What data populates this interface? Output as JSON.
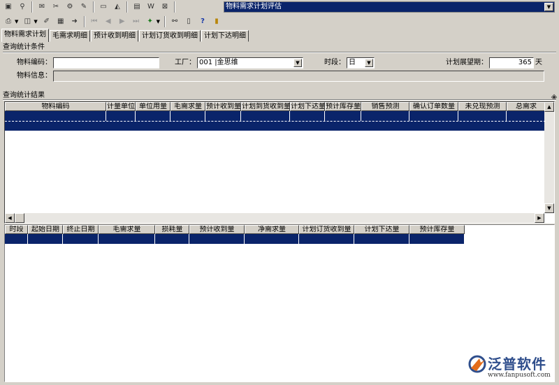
{
  "toolbar1": {
    "icons": [
      "open-icon",
      "find-icon",
      "mail-icon",
      "scissors-icon",
      "gear-icon",
      "plugin-icon",
      "monitor-icon",
      "chart-icon",
      "window-icon",
      "word-icon",
      "close-window-icon"
    ]
  },
  "toolbar2": {
    "icons": [
      "print-icon",
      "print-preview-icon",
      "edit-icon",
      "grid-icon",
      "export-icon",
      "first-icon",
      "prev-icon",
      "next-icon",
      "last-icon",
      "run-icon",
      "network-icon",
      "calculator-icon",
      "help-icon",
      "exit-icon"
    ]
  },
  "module_select": {
    "value": "物料需求计划评估"
  },
  "tabs": [
    {
      "label": "物料需求计划"
    },
    {
      "label": "毛需求明细"
    },
    {
      "label": "预计收到明细"
    },
    {
      "label": "计划订货收到明细"
    },
    {
      "label": "计划下达明细"
    }
  ],
  "query": {
    "section_title": "查询统计条件",
    "material_code_label": "物料编码：",
    "material_code_value": "",
    "factory_label": "工厂：",
    "factory_value": "001 |金思维",
    "period_label": "时段：",
    "period_value": "日",
    "horizon_label": "计划展望期：",
    "horizon_value": "365",
    "horizon_unit": "天",
    "material_info_label": "物料信息："
  },
  "results": {
    "section_title": "查询统计结果",
    "columns": [
      "物料编码",
      "计量单位",
      "单位用量",
      "毛需求量",
      "预计收到量",
      "计划到货收到量",
      "计划下达量",
      "预计库存量",
      "销售预测",
      "确认订单数量",
      "未兑现预测",
      "总需求"
    ]
  },
  "detail": {
    "columns": [
      "时段",
      "起始日期",
      "终止日期",
      "毛需求量",
      "损耗量",
      "预计收到量",
      "净需求量",
      "计划订货收到量",
      "计划下达量",
      "预计库存量"
    ]
  },
  "logo": {
    "name": "泛普软件",
    "url": "www.fanpusoft.com"
  },
  "colors": {
    "selection": "#0a246a",
    "face": "#d4d0c8",
    "logo_blue": "#2f4e8c",
    "logo_orange": "#e36c1a"
  }
}
